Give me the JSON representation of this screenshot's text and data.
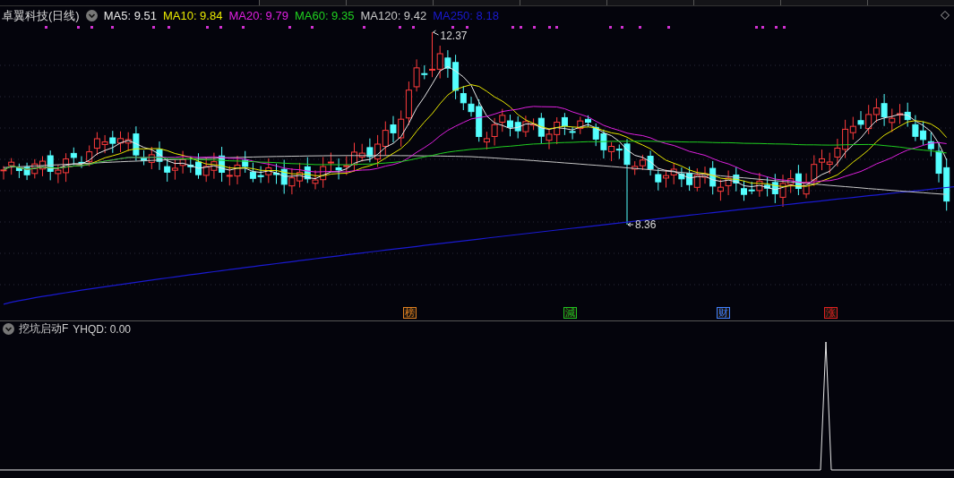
{
  "chart": {
    "title": "卓翼科技(日线)",
    "moving_averages": [
      {
        "text": "MA5: 9.51",
        "color": "#e8e8e8"
      },
      {
        "text": "MA10: 9.84",
        "color": "#e8e800"
      },
      {
        "text": "MA20: 9.79",
        "color": "#e020e0"
      },
      {
        "text": "MA60: 9.35",
        "color": "#20d020"
      },
      {
        "text": "MA120: 9.42",
        "color": "#c8c8c8"
      },
      {
        "text": "MA250: 8.18",
        "color": "#1a1ad0"
      }
    ],
    "high_label": "12.37",
    "low_label": "8.36",
    "event_markers": [
      {
        "text": "榜",
        "color": "#e08020"
      },
      {
        "text": "減",
        "color": "#20c020"
      },
      {
        "text": "财",
        "color": "#4080ff"
      },
      {
        "text": "涨",
        "color": "#e02020"
      }
    ]
  },
  "indicator": {
    "name": "挖坑启动F",
    "reading": "YHQD: 0.00"
  }
}
